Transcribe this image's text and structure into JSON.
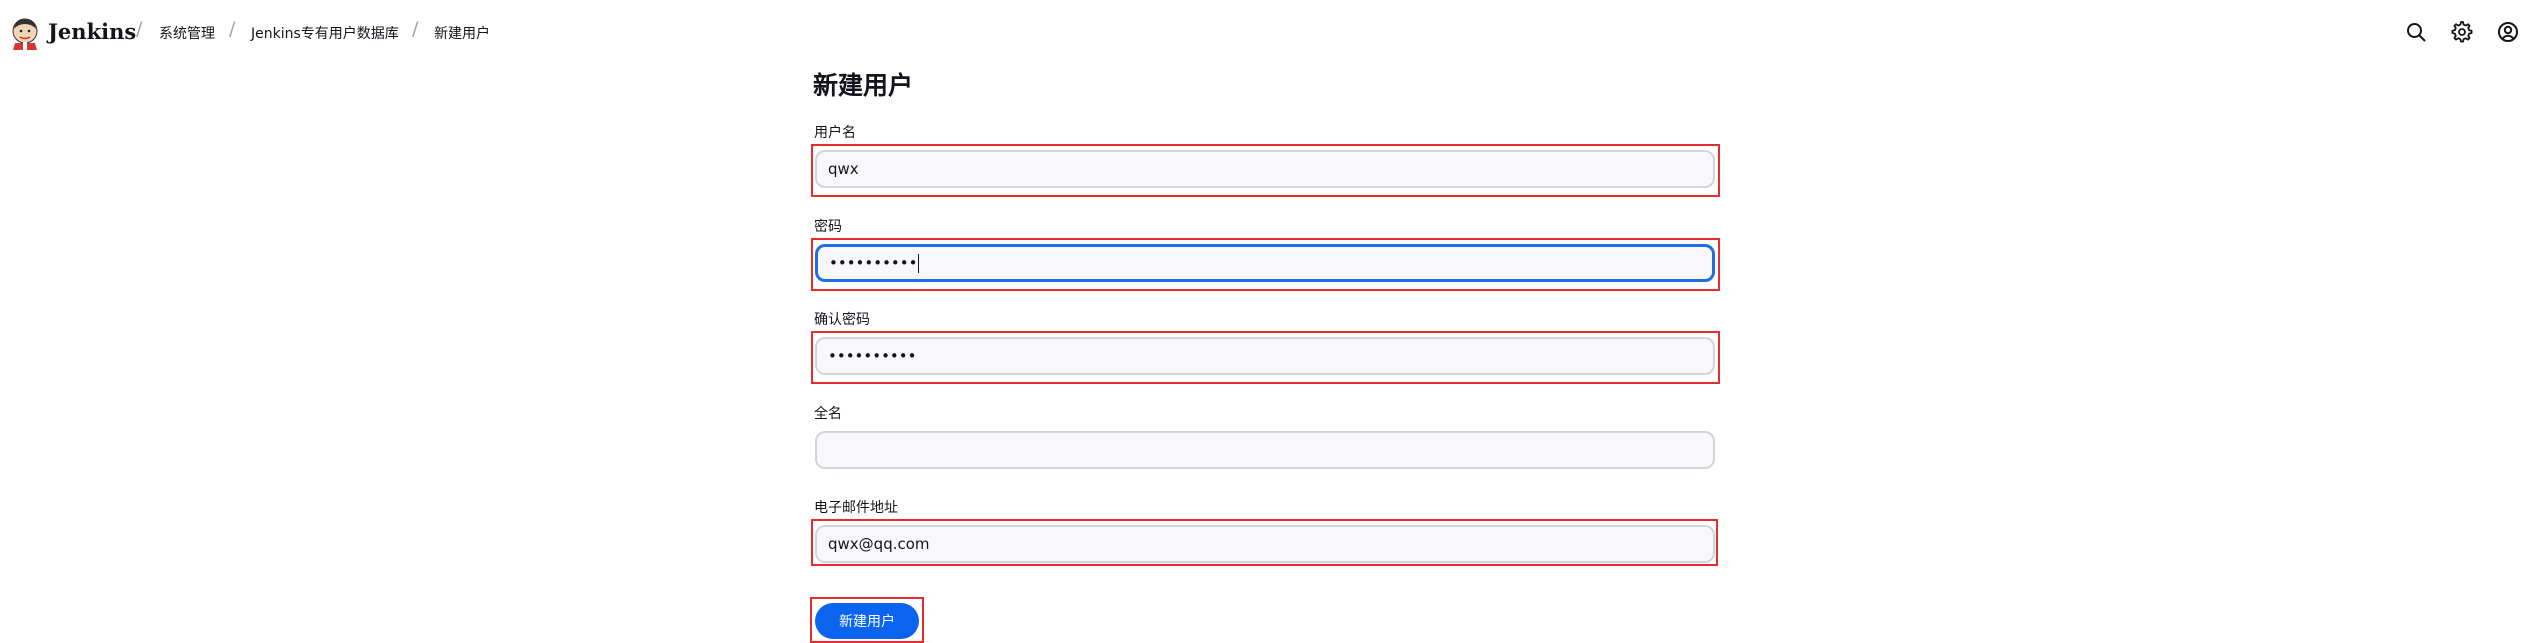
{
  "header": {
    "brand": "Jenkins",
    "breadcrumbs": [
      "系统管理",
      "Jenkins专有用户数据库",
      "新建用户"
    ],
    "separator": "/"
  },
  "icons": {
    "logo": "jenkins-butler-logo",
    "search": "search-icon",
    "settings": "gear-icon",
    "account": "user-circle-icon"
  },
  "form": {
    "title": "新建用户",
    "username": {
      "label": "用户名",
      "value": "qwx"
    },
    "password": {
      "label": "密码",
      "value": "••••••••••"
    },
    "confirm_password": {
      "label": "确认密码",
      "value": "••••••••••"
    },
    "fullname": {
      "label": "全名",
      "value": ""
    },
    "email": {
      "label": "电子邮件地址",
      "value": "qwx@qq.com"
    },
    "submit_label": "新建用户"
  },
  "colors": {
    "accent": "#0a64f0",
    "focus_border": "#1e6fe6",
    "highlight_box": "#e62e2e"
  }
}
